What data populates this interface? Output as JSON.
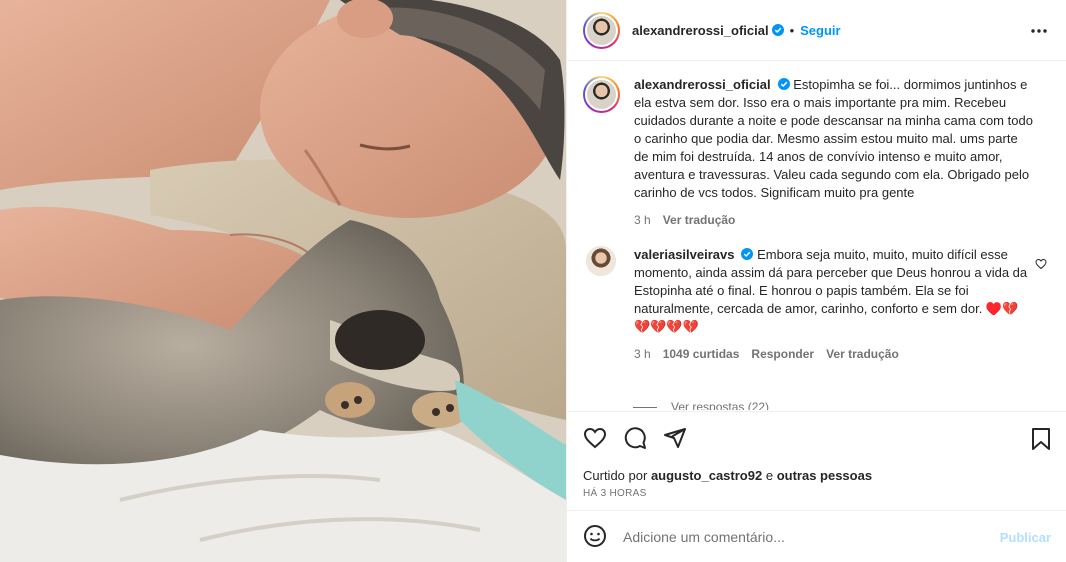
{
  "post": {
    "author": "alexandrerossi_oficial",
    "follow_label": "Seguir",
    "dot": "•",
    "caption_author": "alexandrerossi_oficial",
    "caption": "Estopimha se foi... dormimos juntinhos e ela estva sem dor. Isso era o mais importante pra mim. Recebeu cuidados durante a noite e pode descansar na minha cama com todo o carinho que podia dar. Mesmo assim estou muito mal. ums parte de mim foi destruída. 14 anos de convívio intenso e muito amor, aventura e travessuras. Valeu cada segundo com ela. Obrigado pelo carinho de vcs todos. Significam muito pra gente",
    "caption_time": "3 h",
    "caption_translate": "Ver tradução"
  },
  "comment": {
    "author": "valeriasilveiravs",
    "text": "Embora seja muito, muito, muito difícil esse momento, ainda assim dá para perceber que Deus honrou a vida da Estopinha até o final. E honrou o papis também. Ela se foi naturalmente, cercada de amor, carinho, conforto e sem dor. ♥️💔💔💔💔💔",
    "time": "3 h",
    "likes": "1049 curtidas",
    "reply": "Responder",
    "translate": "Ver tradução",
    "replies": "Ver respostas (22)"
  },
  "actions": {
    "liked_prefix": "Curtido por",
    "liked_user": "augusto_castro92",
    "liked_suffix": "e",
    "liked_others": "outras pessoas",
    "timestamp": "HÁ 3 HORAS"
  },
  "add_comment": {
    "placeholder": "Adicione um comentário...",
    "publish": "Publicar"
  },
  "icons": [
    "more-icon",
    "heart-icon",
    "comment-icon",
    "share-icon",
    "save-icon",
    "emoji-icon",
    "verified-icon"
  ],
  "colors": {
    "accent": "#0095f6",
    "publish_disabled": "#b2dffc",
    "muted": "#737373",
    "text": "#262626"
  }
}
